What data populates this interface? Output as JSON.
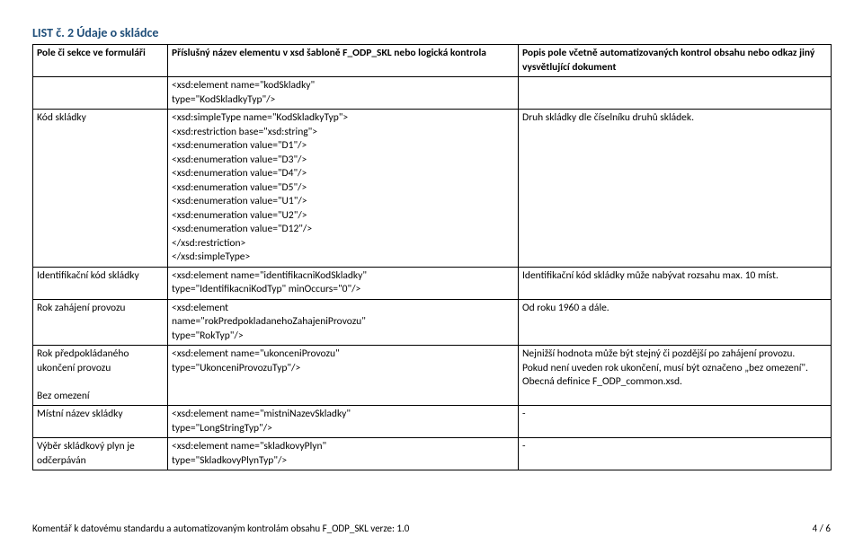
{
  "heading": "LIST č. 2 Údaje o skládce",
  "columns": {
    "c1": "Pole či sekce ve formuláři",
    "c2": "Příslušný název elementu v xsd šabloně F_ODP_SKL nebo logická kontrola",
    "c3": "Popis pole včetně automatizovaných kontrol obsahu nebo odkaz jiný vysvětlující dokument"
  },
  "rows": [
    {
      "c1": "",
      "c2": "<xsd:element name=\"kodSkladky\"\ntype=\"KodSkladkyTyp\"/>",
      "c3": ""
    },
    {
      "c1": "Kód skládky",
      "c2": "<xsd:simpleType name=\"KodSkladkyTyp\">\n<xsd:restriction base=\"xsd:string\">\n<xsd:enumeration value=\"D1\"/>\n<xsd:enumeration value=\"D3\"/>\n<xsd:enumeration value=\"D4\"/>\n<xsd:enumeration value=\"D5\"/>\n<xsd:enumeration value=\"U1\"/>\n<xsd:enumeration value=\"U2\"/>\n<xsd:enumeration value=\"D12\"/>\n</xsd:restriction>\n</xsd:simpleType>",
      "c3": "Druh skládky dle číselníku druhů skládek."
    },
    {
      "c1": "Identifikační kód skládky",
      "c2": "<xsd:element name=\"identifikacniKodSkladky\"\ntype=\"IdentifikacniKodTyp\" minOccurs=\"0\"/>",
      "c3": "Identifikační kód skládky může nabývat rozsahu max. 10 míst."
    },
    {
      "c1": "Rok zahájení provozu",
      "c2": "<xsd:element\nname=\"rokPredpokladanehoZahajeniProvozu\"\ntype=\"RokTyp\"/>",
      "c3": "Od roku 1960 a dále."
    },
    {
      "c1": "Rok předpokládaného ukončení provozu\n\nBez omezení",
      "c2": "<xsd:element name=\"ukonceniProvozu\"\ntype=\"UkonceniProvozuTyp\"/>",
      "c3": "Nejnižší hodnota může být stejný či pozdější po zahájení provozu.\nPokud není uveden rok ukončení, musí být označeno „bez omezení\". Obecná definice F_ODP_common.xsd."
    },
    {
      "c1": "Místní název skládky",
      "c2": "<xsd:element name=\"mistniNazevSkladky\"\ntype=\"LongStringTyp\"/>",
      "c3": "-"
    },
    {
      "c1": "Výběr skládkový plyn je odčerpáván",
      "c2": "<xsd:element name=\"skladkovyPlyn\"\ntype=\"SkladkovyPlynTyp\"/>",
      "c3": "-"
    }
  ],
  "footer": {
    "left": "Komentář k datovému standardu a automatizovaným kontrolám obsahu F_ODP_SKL verze: 1.0",
    "right": "4 / 6"
  }
}
